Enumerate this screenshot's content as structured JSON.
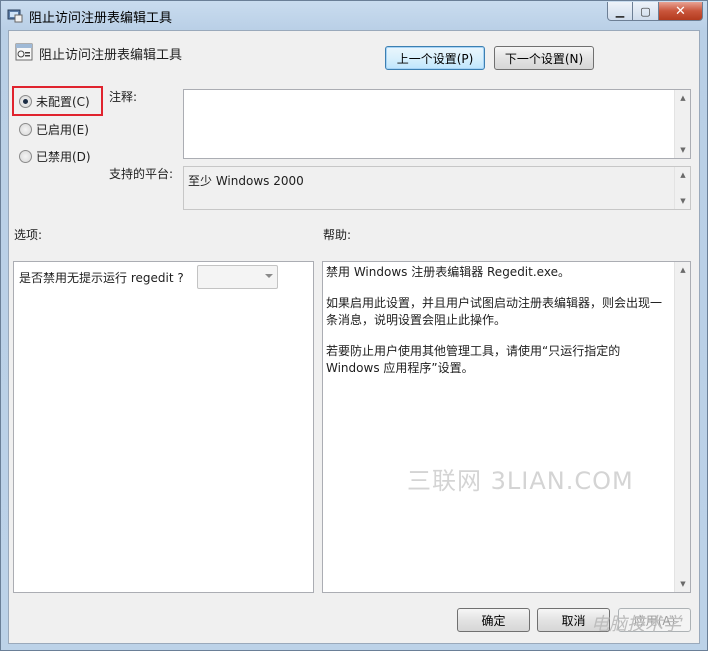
{
  "window": {
    "title": "阻止访问注册表编辑工具",
    "caption": {
      "minimize": "▁",
      "maximize": "▢",
      "close": "✕"
    }
  },
  "header": {
    "policy_name": "阻止访问注册表编辑工具",
    "prev_button": "上一个设置(P)",
    "next_button": "下一个设置(N)"
  },
  "radios": [
    {
      "label": "未配置(C)",
      "selected": true
    },
    {
      "label": "已启用(E)",
      "selected": false
    },
    {
      "label": "已禁用(D)",
      "selected": false
    }
  ],
  "comment": {
    "label": "注释:",
    "value": ""
  },
  "platform": {
    "label": "支持的平台:",
    "value": "至少 Windows 2000"
  },
  "options": {
    "label": "选项:",
    "item_label": "是否禁用无提示运行 regedit ?",
    "select_value": ""
  },
  "help": {
    "label": "帮助:",
    "paragraphs": [
      "禁用 Windows 注册表编辑器 Regedit.exe。",
      "如果启用此设置，并且用户试图启动注册表编辑器，则会出现一条消息，说明设置会阻止此操作。",
      "若要防止用户使用其他管理工具，请使用“只运行指定的 Windows 应用程序”设置。"
    ]
  },
  "footer": {
    "ok": "确定",
    "cancel": "取消",
    "apply": "应用(A)"
  },
  "watermark": {
    "center": "三联网 3LIAN.COM",
    "corner": "电脑技术学"
  },
  "colors": {
    "highlight": "#e0232e",
    "title_gradient_top": "#c9dcef"
  }
}
